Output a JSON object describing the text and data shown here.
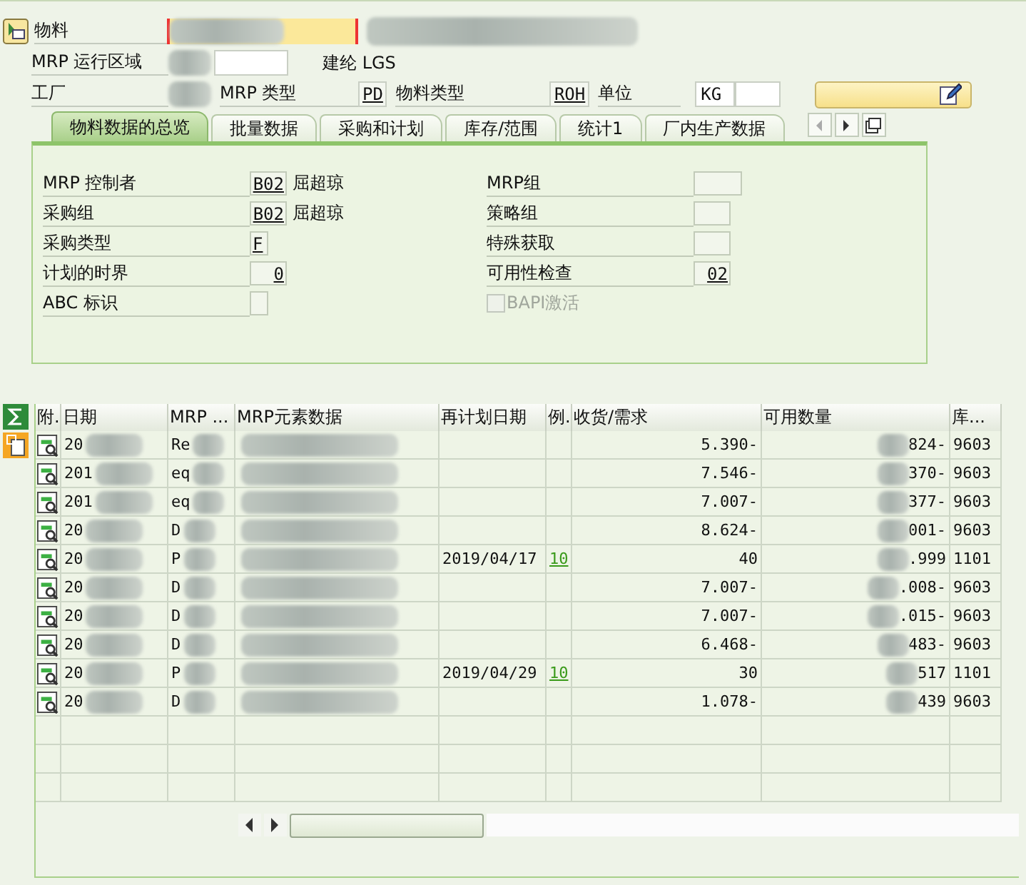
{
  "header": {
    "material_label": "物料",
    "mrp_area_label": "MRP 运行区域",
    "area_text": "建纶 LGS",
    "plant_label": "工厂",
    "mrp_type_label": "MRP 类型",
    "mrp_type": "PD",
    "material_type_label": "物料类型",
    "material_type": "ROH",
    "unit_label": "单位",
    "unit": "KG"
  },
  "tabs": [
    {
      "label": "物料数据的总览",
      "selected": true
    },
    {
      "label": "批量数据",
      "selected": false
    },
    {
      "label": "采购和计划",
      "selected": false
    },
    {
      "label": "库存/范围",
      "selected": false
    },
    {
      "label": "统计1",
      "selected": false
    },
    {
      "label": "厂内生产数据",
      "selected": false
    }
  ],
  "left_fields": [
    {
      "label": "MRP 控制者",
      "value": "B02",
      "desc": "屈超琼"
    },
    {
      "label": "采购组",
      "value": "B02",
      "desc": "屈超琼"
    },
    {
      "label": "采购类型",
      "value": "F"
    },
    {
      "label": "计划的时界",
      "value": "0"
    },
    {
      "label": "ABC 标识"
    }
  ],
  "right_fields": [
    {
      "kind": "field",
      "label": "MRP组"
    },
    {
      "kind": "field",
      "label": "策略组"
    },
    {
      "kind": "field",
      "label": "特殊获取"
    },
    {
      "kind": "field",
      "label": "可用性检查",
      "value": "02"
    },
    {
      "kind": "checkbox",
      "label": "BAPI激活",
      "checked": false,
      "disabled": true
    }
  ],
  "table": {
    "columns": [
      "附.",
      "日期",
      "MRP ...",
      "MRP元素数据",
      "再计划日期",
      "例.",
      "收货/需求",
      "可用数量",
      "库..."
    ],
    "rows": [
      {
        "date": "20",
        "mrp": "Re",
        "qty": "5.390-",
        "avail": "824-",
        "stor": "9603"
      },
      {
        "date": "201",
        "mrp": "eq",
        "qty": "7.546-",
        "avail": "370-",
        "stor": "9603"
      },
      {
        "date": "201",
        "mrp": "eq",
        "qty": "7.007-",
        "avail": "377-",
        "stor": "9603"
      },
      {
        "date": "20",
        "mrp": "D",
        "qty": "8.624-",
        "avail": "001-",
        "stor": "9603"
      },
      {
        "date": "20",
        "mrp": "P",
        "resched": "2019/04/17",
        "exc": "10",
        "qty": "40",
        "avail": ".999",
        "stor": "1101"
      },
      {
        "date": "20",
        "mrp": "D",
        "qty": "7.007-",
        "avail": ".008-",
        "stor": "9603"
      },
      {
        "date": "20",
        "mrp": "D",
        "qty": "7.007-",
        "avail": ".015-",
        "stor": "9603"
      },
      {
        "date": "20",
        "mrp": "D",
        "qty": "6.468-",
        "avail": "483-",
        "stor": "9603"
      },
      {
        "date": "20",
        "mrp": "P",
        "resched": "2019/04/29",
        "exc": "10",
        "qty": "30",
        "avail": "517",
        "stor": "1101"
      },
      {
        "date": "20",
        "mrp": "D",
        "qty": "1.078-",
        "avail": "439",
        "stor": "9603"
      }
    ]
  }
}
